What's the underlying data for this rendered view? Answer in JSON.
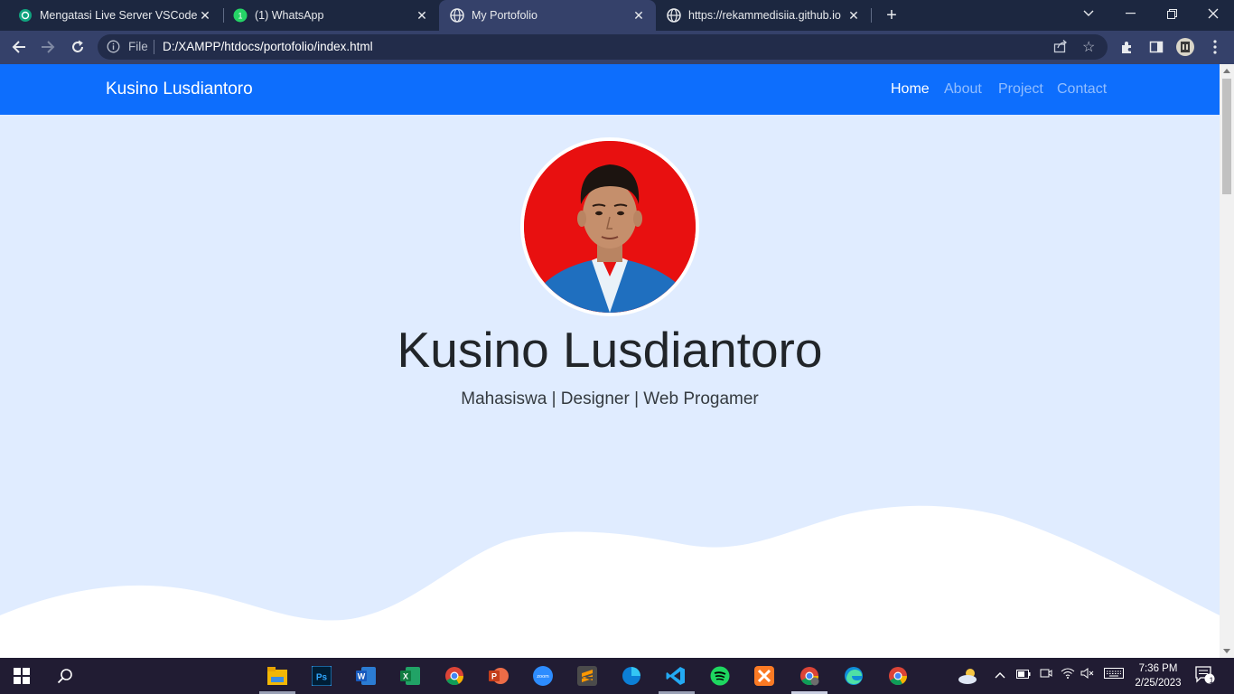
{
  "browser": {
    "tabs": [
      {
        "title": "Mengatasi Live Server VSCode",
        "icon": "chatgpt-icon",
        "active": false
      },
      {
        "title": "(1) WhatsApp",
        "icon": "whatsapp-icon",
        "active": false
      },
      {
        "title": "My Portofolio",
        "icon": "globe-icon",
        "active": true
      },
      {
        "title": "https://rekammedisiia.github.io",
        "icon": "globe-icon",
        "active": false
      }
    ],
    "address": {
      "scheme_label": "File",
      "url": "D:/XAMPP/htdocs/portofolio/index.html"
    }
  },
  "site": {
    "brand": "Kusino Lusdiantoro",
    "nav": [
      {
        "label": "Home",
        "active": true
      },
      {
        "label": "About",
        "active": false
      },
      {
        "label": "Project",
        "active": false
      },
      {
        "label": "Contact",
        "active": false
      }
    ],
    "hero": {
      "name": "Kusino Lusdiantoro",
      "subtitle": "Mahasiswa | Designer | Web Progamer"
    },
    "colors": {
      "navbar": "#0d6efd",
      "hero_bg": "#e0ecff",
      "photo_bg": "#e81010"
    }
  },
  "taskbar": {
    "time": "7:36 PM",
    "date": "2/25/2023",
    "notification_count": "1",
    "apps": [
      "file-explorer-icon",
      "photoshop-icon",
      "word-icon",
      "excel-icon",
      "chrome-icon",
      "powerpoint-icon",
      "zoom-icon",
      "sublime-icon",
      "edge-icon-blue",
      "vscode-icon",
      "spotify-icon",
      "xampp-icon",
      "chrome-profile-icon",
      "edge-icon",
      "chrome-icon-2"
    ]
  }
}
